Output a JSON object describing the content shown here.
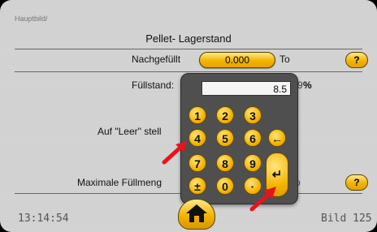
{
  "breadcrumb": "Hauptbild/",
  "title": "Pellet- Lagerstand",
  "rows": {
    "refilled_label": "Nachgefüllt",
    "refilled_value": "0.000",
    "refilled_unit": "To",
    "fill_label": "Füllstand:",
    "fill_partial_value": "9",
    "fill_unit": "%",
    "empty_label": "Auf \"Leer\" stell",
    "max_label": "Maximale Füllmeng",
    "max_partial_unit": "o"
  },
  "help_label": "?",
  "keypad": {
    "display": "8.5",
    "keys_row1": [
      "1",
      "2",
      "3"
    ],
    "keys_row2": [
      "4",
      "5",
      "6",
      "←"
    ],
    "keys_row3": [
      "7",
      "8",
      "9"
    ],
    "keys_row4": [
      "±",
      "0",
      "·"
    ],
    "enter": "↵"
  },
  "footer": {
    "time": "13:14:54",
    "page": "Bild 125"
  },
  "colors": {
    "button_yellow": "#f2b400",
    "annotation_arrow": "#e8141a",
    "keypad_bg": "#4f4f4f"
  }
}
